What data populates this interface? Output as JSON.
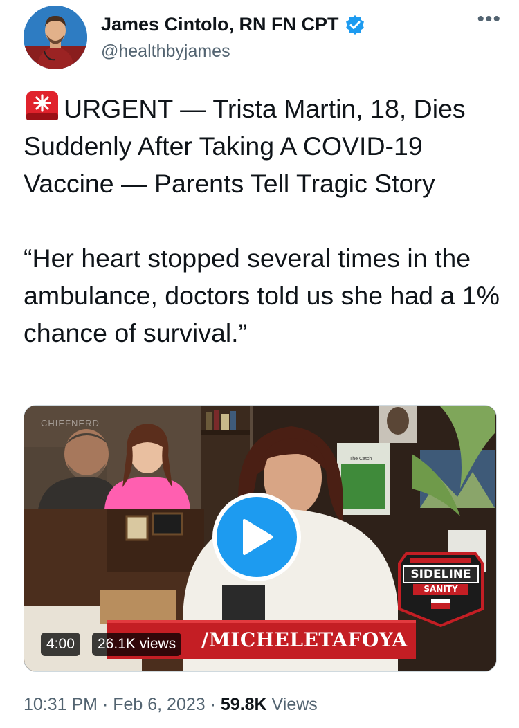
{
  "author": {
    "display_name": "James Cintolo, RN FN CPT",
    "handle": "@healthbyjames",
    "verified_icon": "verified-badge-icon",
    "more_label": "•••"
  },
  "tweet": {
    "siren_icon": "rotating-light-emoji",
    "headline": "URGENT — Trista Martin, 18, Dies Suddenly After Taking A COVID-19 Vaccine — Parents Tell Tragic Story",
    "quote": "“Her heart stopped several times in the ambulance, doctors told us she had a 1% chance of survival.”"
  },
  "video": {
    "duration": "4:00",
    "views": "26.1K views",
    "banner_text": "/MICHELETAFOYA",
    "sideline_title": "SIDELINE",
    "sideline_subtitle": "SANITY",
    "watermark": "CHIEFNERD",
    "board_title": "The Catch"
  },
  "meta": {
    "time": "10:31 PM",
    "separator1": " · ",
    "date": "Feb 6, 2023",
    "separator2": " · ",
    "view_count": "59.8K",
    "views_label": " Views"
  },
  "colors": {
    "accent": "#1d9bf0",
    "secondary_text": "#536471",
    "banner_red": "#c41e24"
  }
}
